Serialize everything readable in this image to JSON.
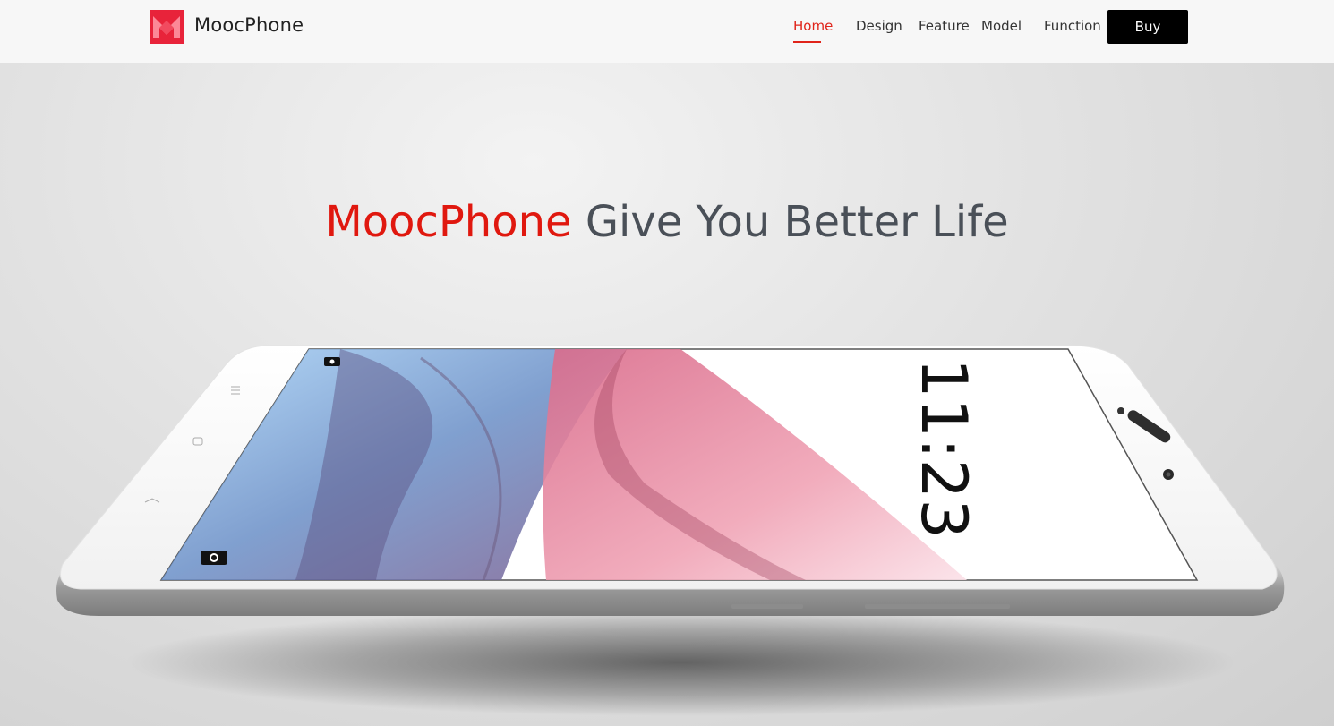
{
  "header": {
    "brand": "MoocPhone",
    "nav": [
      {
        "label": "Home",
        "active": true
      },
      {
        "label": "Design",
        "active": false
      },
      {
        "label": "Feature",
        "active": false
      },
      {
        "label": "Model",
        "active": false
      },
      {
        "label": "Function",
        "active": false
      }
    ],
    "buy_label": "Buy"
  },
  "hero": {
    "headline_brand": "MoocPhone",
    "headline_rest": "Give You Better Life"
  },
  "phone_screen": {
    "clock": "11:23"
  },
  "colors": {
    "accent": "#e0241a",
    "headline_gray": "#4a5058",
    "buy_bg": "#000000",
    "topbar_bg": "#f7f7f7"
  },
  "icons": {
    "logo": "m-logo-icon",
    "camera": "camera-icon",
    "menu": "menu-icon",
    "home": "home-icon",
    "back": "back-icon"
  }
}
